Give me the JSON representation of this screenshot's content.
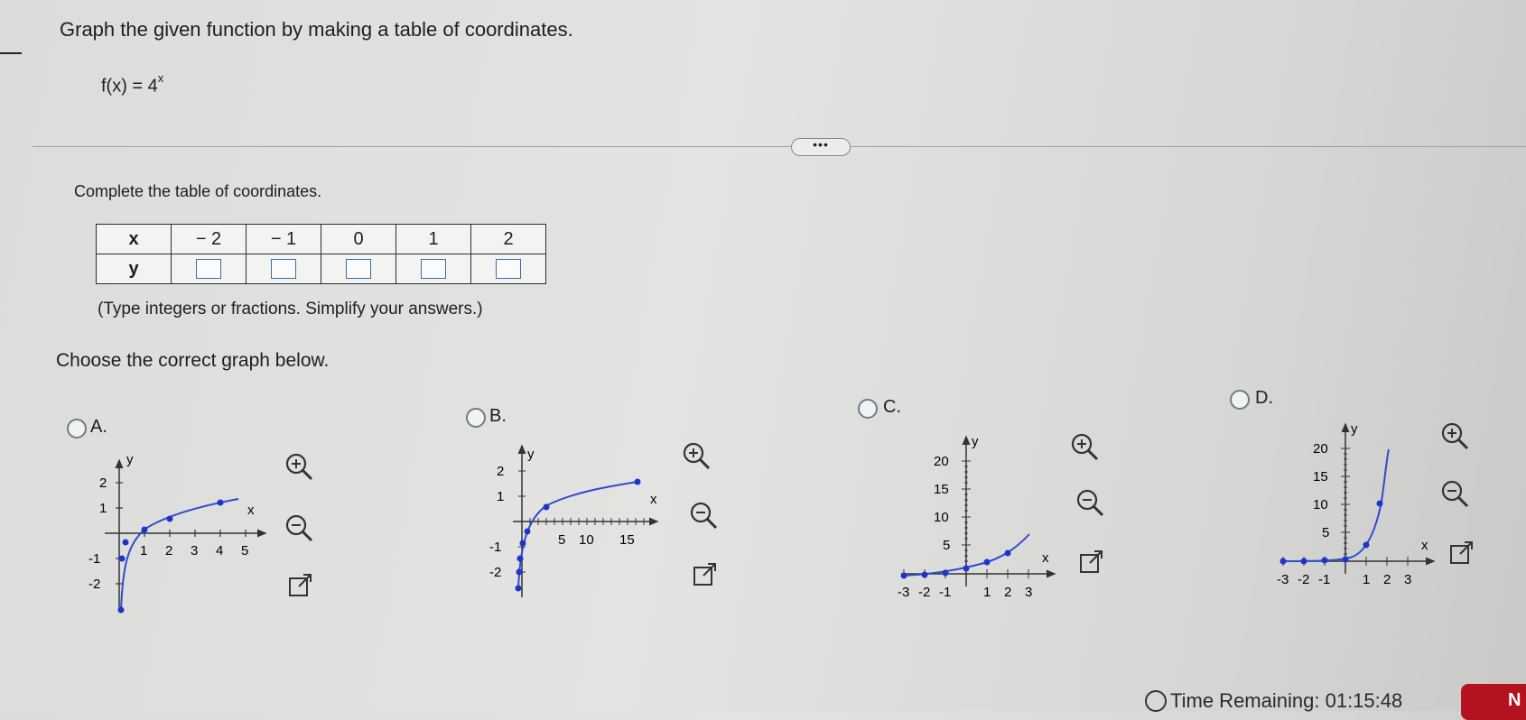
{
  "question": {
    "prompt": "Graph the given function by making a table of coordinates.",
    "function": "f(x) = 4",
    "function_exponent": "x",
    "more_button": "•••"
  },
  "table_section": {
    "instruction": "Complete the table of coordinates.",
    "x_label": "x",
    "y_label": "y",
    "x_values": [
      "− 2",
      "− 1",
      "0",
      "1",
      "2"
    ],
    "hint": "(Type integers or fractions. Simplify your answers.)"
  },
  "graph_section": {
    "instruction": "Choose the correct graph below.",
    "options": [
      {
        "label": "A.",
        "icons": [
          "zoom-in-icon",
          "zoom-out-icon",
          "popout-icon"
        ]
      },
      {
        "label": "B.",
        "icons": [
          "zoom-in-icon",
          "zoom-out-icon",
          "popout-icon"
        ]
      },
      {
        "label": "C.",
        "icons": [
          "zoom-in-icon",
          "zoom-out-icon",
          "popout-icon"
        ]
      },
      {
        "label": "D.",
        "icons": [
          "zoom-in-icon",
          "zoom-out-icon",
          "popout-icon"
        ]
      }
    ]
  },
  "graphs": {
    "a": {
      "y_label": "y",
      "x_label": "x",
      "y_ticks": [
        "2",
        "1",
        "-1",
        "-2"
      ],
      "x_ticks": [
        "1",
        "2",
        "3",
        "4",
        "5"
      ]
    },
    "b": {
      "y_label": "y",
      "x_label": "x",
      "y_ticks": [
        "2",
        "1",
        "-1",
        "-2"
      ],
      "x_ticks": [
        "5",
        "10",
        "15"
      ]
    },
    "c": {
      "y_label": "y",
      "x_label": "x",
      "y_ticks": [
        "20",
        "15",
        "10",
        "5"
      ],
      "x_ticks": [
        "-3",
        "-2",
        "-1",
        "1",
        "2",
        "3"
      ]
    },
    "d": {
      "y_label": "y",
      "x_label": "x",
      "y_ticks": [
        "20",
        "15",
        "10",
        "5"
      ],
      "x_ticks": [
        "-3",
        "-2",
        "-1",
        "1",
        "2",
        "3"
      ]
    }
  },
  "footer": {
    "timer_label": "Time Remaining:",
    "timer_value": "01:15:48",
    "next_button": "N"
  },
  "colors": {
    "curve": "#2f4bd0",
    "point": "#1c36c8",
    "radio_border": "#6a7d8c",
    "next_button": "#b3121f"
  }
}
